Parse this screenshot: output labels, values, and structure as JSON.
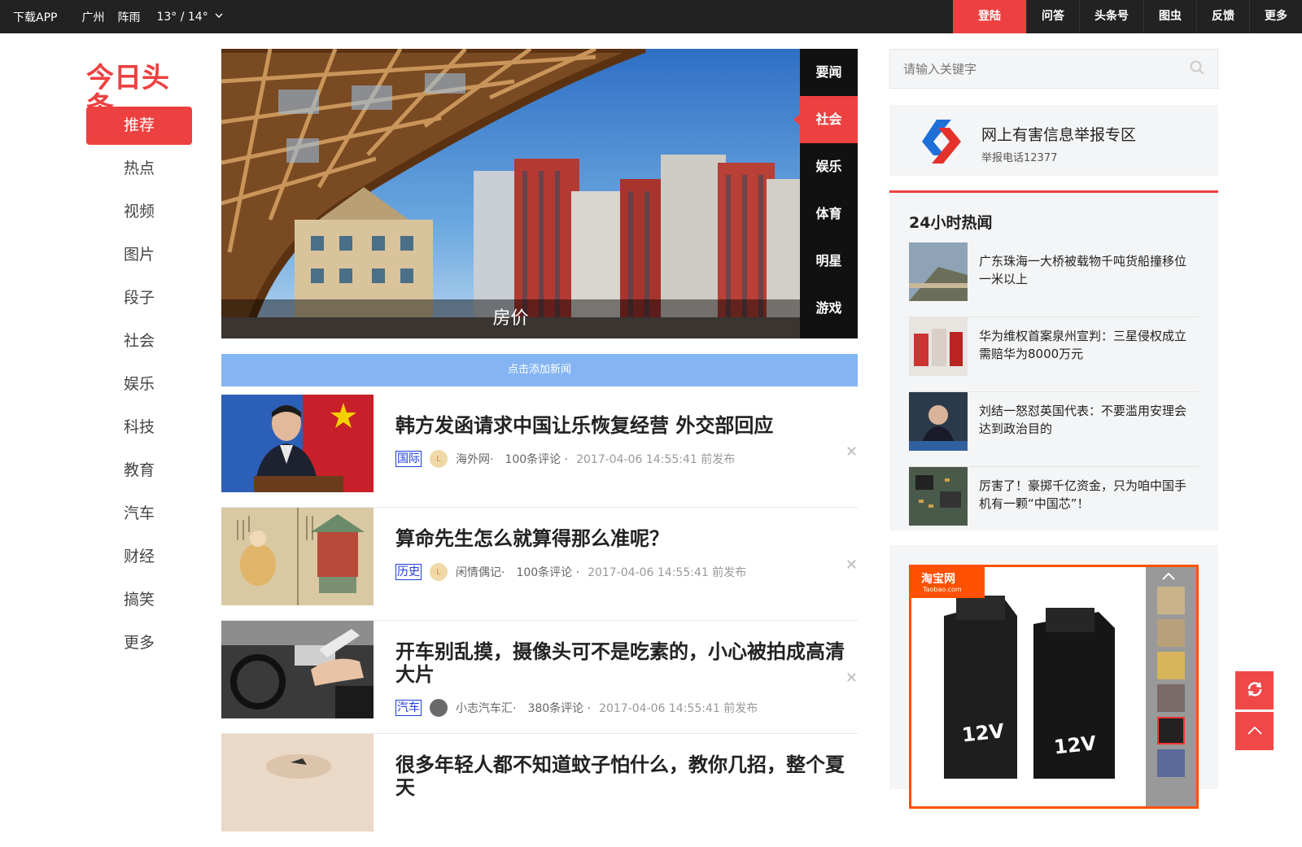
{
  "topbar": {
    "download": "下载APP",
    "city": "广州",
    "weather": "阵雨",
    "temp": "13° / 14°",
    "login": "登陆",
    "links": [
      "问答",
      "头条号",
      "图虫",
      "反馈",
      "更多"
    ]
  },
  "logo": "今日头条",
  "nav": [
    "推荐",
    "热点",
    "视频",
    "图片",
    "段子",
    "社会",
    "娱乐",
    "科技",
    "教育",
    "汽车",
    "财经",
    "搞笑",
    "更多"
  ],
  "carousel": {
    "caption": "房价",
    "tabs": [
      "要闻",
      "社会",
      "娱乐",
      "体育",
      "明星",
      "游戏"
    ],
    "active_tab": 1
  },
  "add_news": "点击添加新闻",
  "feed": [
    {
      "title": "韩方发函请求中国让乐恢复经营 外交部回应",
      "tag": "国际",
      "source": "海外网·",
      "comments": "100条评论 ·",
      "time": "2017-04-06 14:55:41 前发布"
    },
    {
      "title": "算命先生怎么就算得那么准呢？",
      "tag": "历史",
      "source": "闲情偶记·",
      "comments": "100条评论 ·",
      "time": "2017-04-06 14:55:41 前发布"
    },
    {
      "title": "开车别乱摸，摄像头可不是吃素的，小心被拍成高清大片",
      "tag": "汽车",
      "source": "小志汽车汇·",
      "comments": "380条评论 ·",
      "time": "2017-04-06 14:55:41 前发布"
    },
    {
      "title": "很多年轻人都不知道蚊子怕什么，教你几招，整个夏天",
      "tag": "",
      "source": "",
      "comments": "",
      "time": ""
    }
  ],
  "search": {
    "placeholder": "请输入关键字"
  },
  "report": {
    "title": "网上有害信息举报专区",
    "sub": "举报电话12377"
  },
  "hot": {
    "title": "24小时热闻",
    "items": [
      "广东珠海一大桥被载物千吨货船撞移位一米以上",
      "华为维权首案泉州宣判：三星侵权成立需赔华为8000万元",
      "刘结一怒怼英国代表：不要滥用安理会达到政治目的",
      "厉害了！豪掷千亿资金，只为咱中国手机有一颗“中国芯”！"
    ]
  },
  "ad": {
    "brand": "淘宝网",
    "brand_en": "Taobao.com",
    "product_text": "12V"
  },
  "colors": {
    "accent": "#ed4040",
    "topbar": "#222222",
    "add_news": "#85b4f2",
    "tag": "#1c3cd8"
  }
}
